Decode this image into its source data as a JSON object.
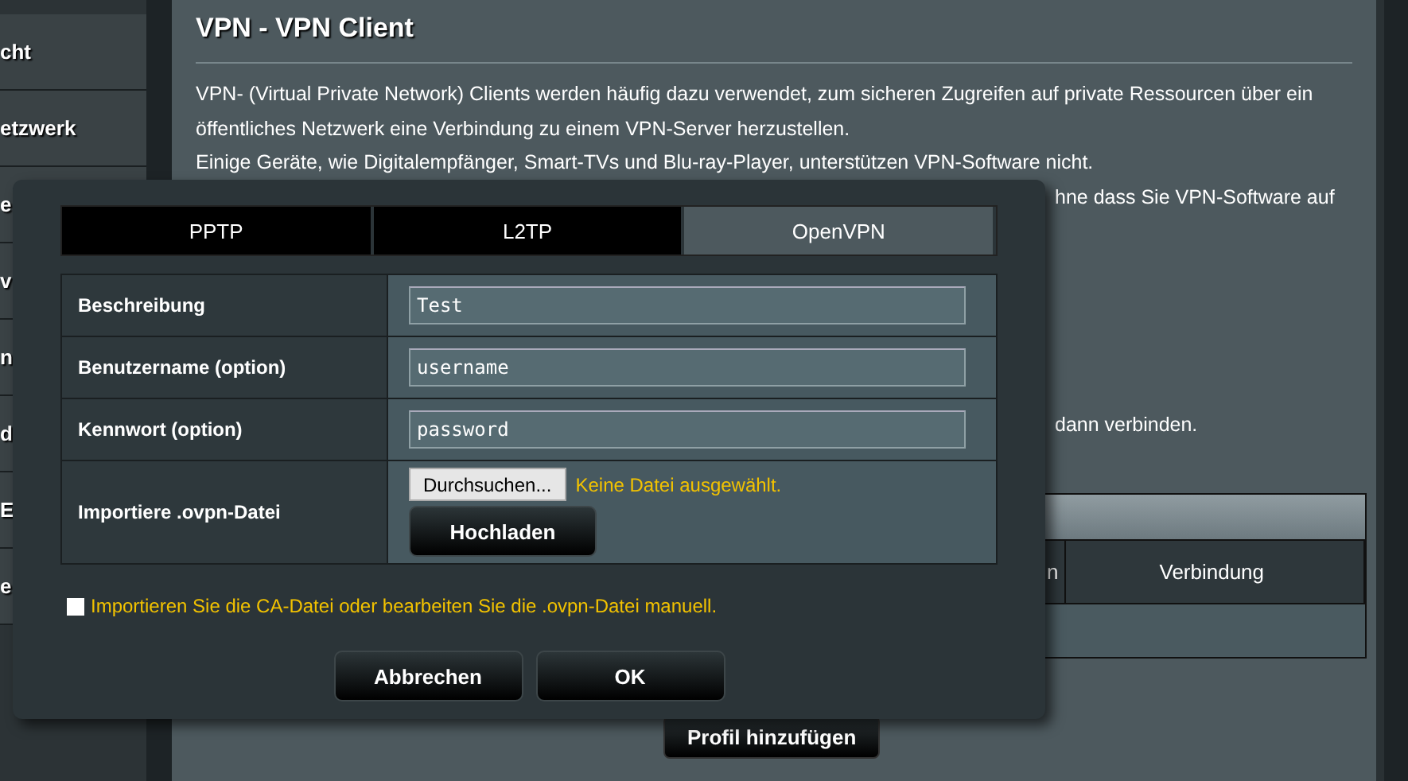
{
  "sidebar": {
    "items": [
      {
        "label": "cht"
      },
      {
        "label": "etzwerk"
      },
      {
        "label": "e"
      },
      {
        "label": "v"
      },
      {
        "label": "n"
      },
      {
        "label": "d"
      },
      {
        "label": "E"
      },
      {
        "label": "e"
      }
    ]
  },
  "page": {
    "title": "VPN - VPN Client",
    "paragraph": [
      "VPN- (Virtual Private Network) Clients werden häufig dazu verwendet, zum sicheren Zugreifen auf private Ressourcen über ein öffentliches Netzwerk eine Verbindung zu einem VPN-Server herzustellen.",
      "Einige Geräte, wie Digitalempfänger, Smart-TVs und Blu-ray-Player, unterstützen VPN-Software nicht."
    ],
    "partial_lines": [
      "hne dass Sie VPN-Software auf",
      "dann verbinden."
    ],
    "table": {
      "columns": [
        "n",
        "Verbindung"
      ]
    },
    "add_button": "Profil hinzufügen"
  },
  "dialog": {
    "tabs": [
      {
        "label": "PPTP",
        "selected": false
      },
      {
        "label": "L2TP",
        "selected": false
      },
      {
        "label": "OpenVPN",
        "selected": true
      }
    ],
    "fields": [
      {
        "label": "Beschreibung",
        "value": "Test"
      },
      {
        "label": "Benutzername (option)",
        "value": "username"
      },
      {
        "label": "Kennwort (option)",
        "value": "password"
      }
    ],
    "import": {
      "label": "Importiere .ovpn-Datei",
      "browse": "Durchsuchen...",
      "status": "Keine Datei ausgewählt.",
      "upload": "Hochladen"
    },
    "manual": {
      "label": "Importieren Sie die CA-Datei oder bearbeiten Sie die .ovpn-Datei manuell.",
      "checked": false
    },
    "buttons": [
      "Abbrechen",
      "OK"
    ]
  }
}
